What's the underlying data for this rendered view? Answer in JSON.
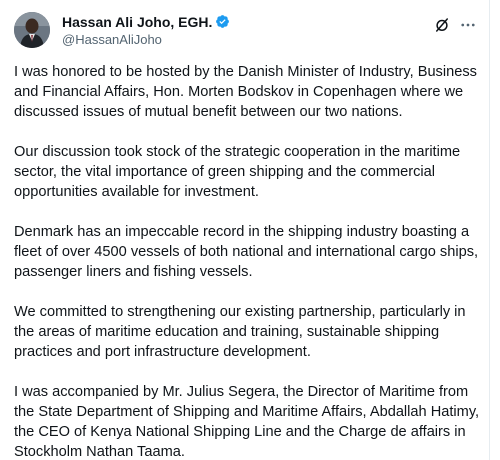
{
  "author": {
    "display_name": "Hassan Ali Joho, EGH.",
    "handle": "@HassanAliJoho",
    "verified": true,
    "verified_color": "#1d9bf0"
  },
  "actions": {
    "grok_icon": "grok-slash-icon",
    "more_icon": "more-ellipsis-icon"
  },
  "tweet": {
    "paragraphs": [
      "I was honored to be hosted by the Danish Minister of Industry, Business and Financial Affairs, Hon. Morten Bodskov in Copenhagen where we discussed issues of mutual benefit between our two nations.",
      "Our discussion took stock of the strategic cooperation in the maritime sector, the vital importance of green shipping and the commercial opportunities available for investment.",
      "Denmark has an impeccable record in the shipping industry boasting a fleet of over 4500 vessels of both national and international cargo ships, passenger liners and fishing vessels.",
      "We committed to strengthening our existing partnership, particularly in the areas of maritime education and training, sustainable shipping practices and port infrastructure development.",
      "I was accompanied by Mr. Julius Segera, the Director of Maritime from the State Department of Shipping and Maritime Affairs, Abdallah Hatimy, the CEO of Kenya National Shipping Line and the Charge de affairs in Stockholm Nathan Taama."
    ]
  }
}
